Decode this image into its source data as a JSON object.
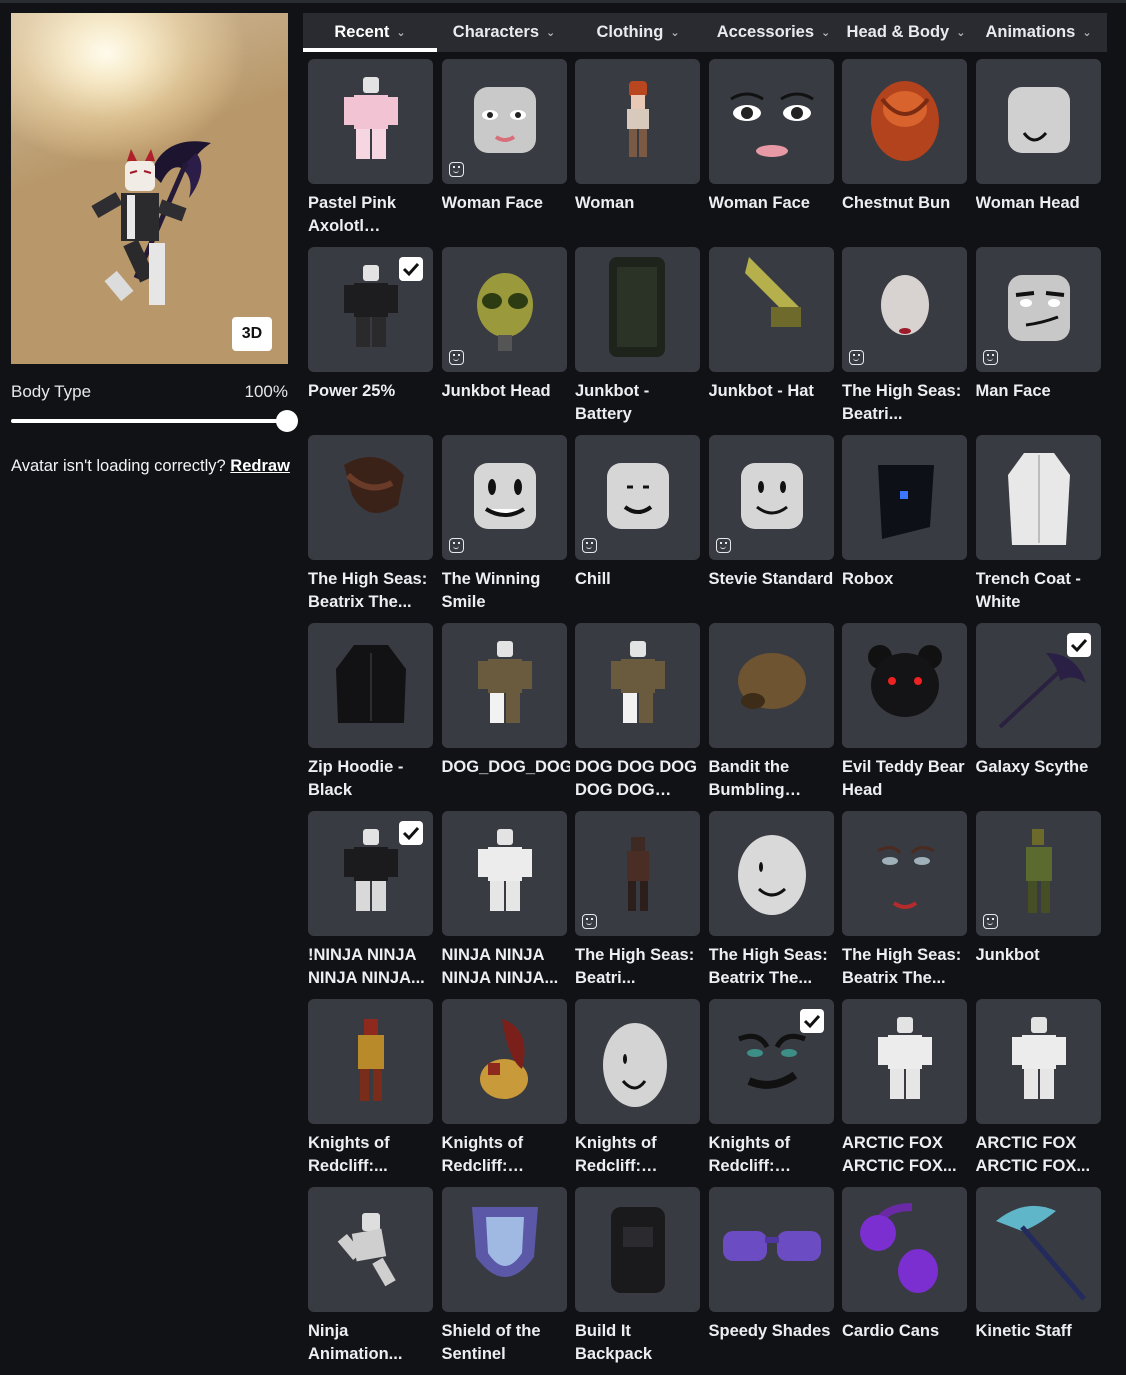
{
  "left": {
    "view_button": "3D",
    "body_type_label": "Body Type",
    "body_type_value": "100%",
    "body_type_fraction": 1.0,
    "redraw_text": "Avatar isn't loading correctly?",
    "redraw_link": "Redraw"
  },
  "tabs": [
    {
      "label": "Recent",
      "active": true
    },
    {
      "label": "Characters",
      "active": false
    },
    {
      "label": "Clothing",
      "active": false
    },
    {
      "label": "Accessories",
      "active": false
    },
    {
      "label": "Head & Body",
      "active": false
    },
    {
      "label": "Animations",
      "active": false
    }
  ],
  "items": [
    {
      "name": "Pastel Pink Axolotl School...",
      "icon": "pink-outfit-avatar",
      "checked": false,
      "face_badge": false
    },
    {
      "name": "Woman Face",
      "icon": "woman-face-head",
      "checked": false,
      "face_badge": true
    },
    {
      "name": "Woman",
      "icon": "woman-character",
      "checked": false,
      "face_badge": false
    },
    {
      "name": "Woman Face",
      "icon": "woman-face-closeup",
      "checked": false,
      "face_badge": false
    },
    {
      "name": "Chestnut Bun",
      "icon": "chestnut-bun-hair",
      "checked": false,
      "face_badge": false
    },
    {
      "name": "Woman Head",
      "icon": "woman-head",
      "checked": false,
      "face_badge": false
    },
    {
      "name": "Power 25%",
      "icon": "black-outfit-avatar",
      "checked": true,
      "face_badge": false
    },
    {
      "name": "Junkbot Head",
      "icon": "junkbot-head",
      "checked": false,
      "face_badge": true
    },
    {
      "name": "Junkbot - Battery",
      "icon": "battery-pack",
      "checked": false,
      "face_badge": false
    },
    {
      "name": "Junkbot - Hat",
      "icon": "junkbot-hat",
      "checked": false,
      "face_badge": false
    },
    {
      "name": "The High Seas: Beatri...",
      "icon": "beatrix-head",
      "checked": false,
      "face_badge": true
    },
    {
      "name": "Man Face",
      "icon": "man-face-head",
      "checked": false,
      "face_badge": true
    },
    {
      "name": "The High Seas: Beatrix The...",
      "icon": "pirate-hat",
      "checked": false,
      "face_badge": false
    },
    {
      "name": "The Winning Smile",
      "icon": "winning-smile-head",
      "checked": false,
      "face_badge": true
    },
    {
      "name": "Chill",
      "icon": "chill-head",
      "checked": false,
      "face_badge": true
    },
    {
      "name": "Stevie Standard",
      "icon": "stevie-head",
      "checked": false,
      "face_badge": true
    },
    {
      "name": "Robox",
      "icon": "robox-head",
      "checked": false,
      "face_badge": false
    },
    {
      "name": "Trench Coat - White",
      "icon": "trench-coat",
      "checked": false,
      "face_badge": false
    },
    {
      "name": "Zip Hoodie - Black",
      "icon": "black-hoodie",
      "checked": false,
      "face_badge": false
    },
    {
      "name": "DOG_DOG_DOG...",
      "icon": "dog-outfit-avatar",
      "checked": false,
      "face_badge": false
    },
    {
      "name": "DOG DOG DOG DOG DOG DOG...",
      "icon": "dog-outfit-avatar-2",
      "checked": false,
      "face_badge": false
    },
    {
      "name": "Bandit the Bumbling Puppy",
      "icon": "puppy-head",
      "checked": false,
      "face_badge": false
    },
    {
      "name": "Evil Teddy Bear Head",
      "icon": "teddy-bear-head",
      "checked": false,
      "face_badge": false
    },
    {
      "name": "Galaxy Scythe",
      "icon": "galaxy-scythe",
      "checked": true,
      "face_badge": false
    },
    {
      "name": "!NINJA NINJA NINJA NINJA...",
      "icon": "ninja-outfit-avatar",
      "checked": true,
      "face_badge": false
    },
    {
      "name": "NINJA NINJA NINJA NINJA...",
      "icon": "white-avatar",
      "checked": false,
      "face_badge": false
    },
    {
      "name": "The High Seas: Beatri...",
      "icon": "pirate-character",
      "checked": false,
      "face_badge": true
    },
    {
      "name": "The High Seas: Beatrix The...",
      "icon": "smiling-head",
      "checked": false,
      "face_badge": false
    },
    {
      "name": "The High Seas: Beatrix The...",
      "icon": "beatrix-face",
      "checked": false,
      "face_badge": false
    },
    {
      "name": "Junkbot",
      "icon": "junkbot-character",
      "checked": false,
      "face_badge": true
    },
    {
      "name": "Knights of Redcliff:...",
      "icon": "knight-character",
      "checked": false,
      "face_badge": false
    },
    {
      "name": "Knights of Redcliff: Paladi...",
      "icon": "paladin-helmet",
      "checked": false,
      "face_badge": false
    },
    {
      "name": "Knights of Redcliff: Paladi...",
      "icon": "paladin-head",
      "checked": false,
      "face_badge": false
    },
    {
      "name": "Knights of Redcliff: Paladi...",
      "icon": "paladin-face",
      "checked": true,
      "face_badge": false
    },
    {
      "name": "ARCTIC FOX ARCTIC FOX...",
      "icon": "arctic-fox-avatar",
      "checked": false,
      "face_badge": false
    },
    {
      "name": "ARCTIC FOX ARCTIC FOX...",
      "icon": "arctic-fox-avatar-2",
      "checked": false,
      "face_badge": false
    },
    {
      "name": "Ninja Animation...",
      "icon": "ninja-animation",
      "checked": false,
      "face_badge": false
    },
    {
      "name": "Shield of the Sentinel",
      "icon": "sentinel-shield",
      "checked": false,
      "face_badge": false
    },
    {
      "name": "Build It Backpack",
      "icon": "backpack",
      "checked": false,
      "face_badge": false
    },
    {
      "name": "Speedy Shades",
      "icon": "shades",
      "checked": false,
      "face_badge": false
    },
    {
      "name": "Cardio Cans",
      "icon": "headphones",
      "checked": false,
      "face_badge": false
    },
    {
      "name": "Kinetic Staff",
      "icon": "kinetic-staff",
      "checked": false,
      "face_badge": false
    }
  ]
}
